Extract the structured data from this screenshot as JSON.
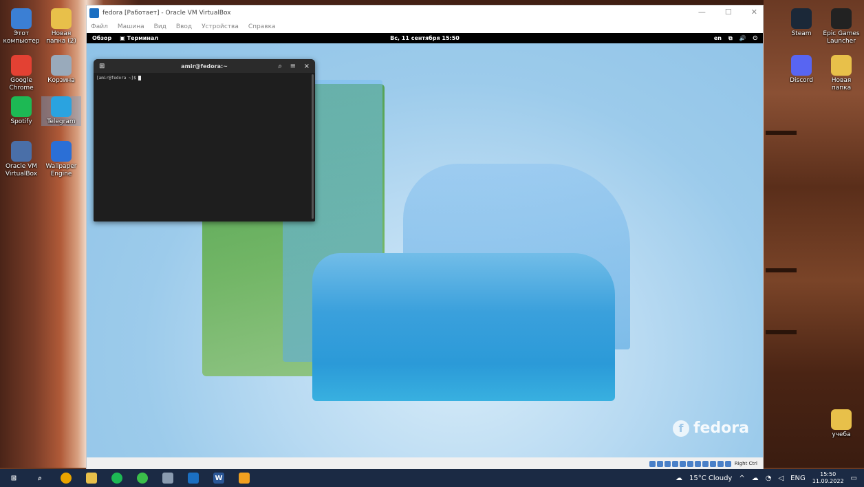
{
  "desktop_left": [
    {
      "label": "Этот компьютер",
      "icon": "computer-icon",
      "color": "#3b7fd4"
    },
    {
      "label": "Новая папка (2)",
      "icon": "folder-icon",
      "color": "#e8c04a"
    },
    {
      "label": "Google Chrome",
      "icon": "chrome-icon",
      "color": "#e34133"
    },
    {
      "label": "Корзина",
      "icon": "recycle-bin-icon",
      "color": "#9ab"
    },
    {
      "label": "Spotify",
      "icon": "spotify-icon",
      "color": "#1db954"
    },
    {
      "label": "Telegram",
      "icon": "telegram-icon",
      "color": "#2aa3e0"
    },
    {
      "label": "Oracle VM VirtualBox",
      "icon": "virtualbox-icon",
      "color": "#4a6fa8"
    },
    {
      "label": "Wallpaper Engine",
      "icon": "wallpaper-engine-icon",
      "color": "#2b6fd6"
    }
  ],
  "desktop_right": [
    {
      "label": "Steam",
      "icon": "steam-icon",
      "color": "#1b2838"
    },
    {
      "label": "Epic Games Launcher",
      "icon": "epic-games-icon",
      "color": "#222"
    },
    {
      "label": "Discord",
      "icon": "discord-icon",
      "color": "#5865f2"
    },
    {
      "label": "Новая папка",
      "icon": "folder-icon",
      "color": "#e8c04a"
    },
    {
      "label": "учеба",
      "icon": "folder-icon",
      "color": "#e8c04a"
    }
  ],
  "vbox": {
    "title": "fedora [Работает] - Oracle VM VirtualBox",
    "menu": [
      "Файл",
      "Машина",
      "Вид",
      "Ввод",
      "Устройства",
      "Справка"
    ],
    "status_right": "Right Ctrl"
  },
  "gnome": {
    "activities": "Обзор",
    "app": "Терминал",
    "clock": "Вс, 11 сентября  15:50",
    "lang": "en"
  },
  "terminal": {
    "title": "amir@fedora:~",
    "prompt": "[amir@fedora ~]$ "
  },
  "fedora_brand": "fedora",
  "taskbar": {
    "weather": "15°C  Cloudy",
    "lang": "ENG",
    "time": "15:50",
    "date": "11.09.2022"
  }
}
